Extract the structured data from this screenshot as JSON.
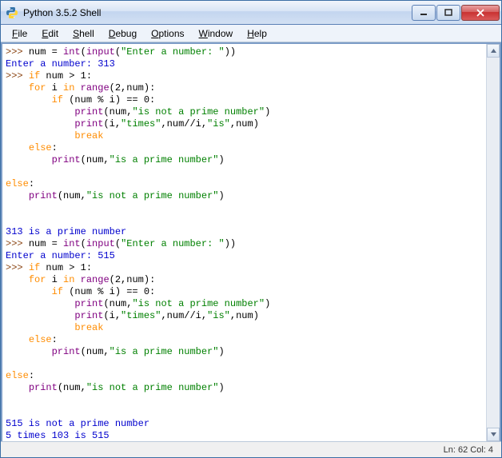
{
  "window": {
    "title": "Python 3.5.2 Shell"
  },
  "menu": {
    "file": "File",
    "edit": "Edit",
    "shell": "Shell",
    "debug": "Debug",
    "options": "Options",
    "window": "Window",
    "help": "Help"
  },
  "code": {
    "p1": ">>> ",
    "l1a": "num = ",
    "l1b": "int",
    "l1c": "(",
    "l1d": "input",
    "l1e": "(",
    "l1f": "\"Enter a number: \"",
    "l1g": "))",
    "o1": "Enter a number: 313",
    "l2": "if",
    "l2b": " num > 1:",
    "l3a": "    ",
    "l3kw": "for",
    "l3b": " i ",
    "l3kw2": "in",
    "l3c": " ",
    "l3fn": "range",
    "l3d": "(2,num):",
    "l4a": "        ",
    "l4kw": "if",
    "l4b": " (num % i) == 0:",
    "l5a": "            ",
    "l5fn": "print",
    "l5b": "(num,",
    "l5s": "\"is not a prime number\"",
    "l5c": ")",
    "l6a": "            ",
    "l6fn": "print",
    "l6b": "(i,",
    "l6s1": "\"times\"",
    "l6c": ",num//i,",
    "l6s2": "\"is\"",
    "l6d": ",num)",
    "l7a": "            ",
    "l7kw": "break",
    "l8a": "    ",
    "l8kw": "else",
    "l8b": ":",
    "l9a": "        ",
    "l9fn": "print",
    "l9b": "(num,",
    "l9s": "\"is a prime number\"",
    "l9c": ")",
    "l10kw": "else",
    "l10b": ":",
    "l11a": "    ",
    "l11fn": "print",
    "l11b": "(num,",
    "l11s": "\"is not a prime number\"",
    "l11c": ")",
    "out1": "313 is a prime number",
    "o2": "Enter a number: 515",
    "out2a": "515 is not a prime number",
    "out2b": "5 times 103 is 515"
  },
  "status": {
    "pos": "Ln: 62  Col: 4"
  }
}
